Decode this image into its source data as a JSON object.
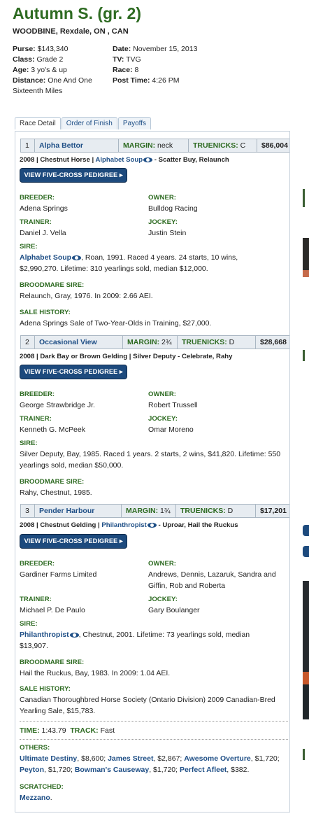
{
  "race": {
    "title": "Autumn S. (gr. 2)",
    "location": "WOODBINE, Rexdale, ON , CAN",
    "info_left": [
      {
        "label": "Purse:",
        "value": "$143,340"
      },
      {
        "label": "Class:",
        "value": "Grade 2"
      },
      {
        "label": "Age:",
        "value": "3 yo's & up"
      },
      {
        "label": "Distance:",
        "value": "One And One Sixteenth Miles"
      }
    ],
    "info_right": [
      {
        "label": "Date:",
        "value": "November 15, 2013"
      },
      {
        "label": "TV:",
        "value": "TVG"
      },
      {
        "label": "Race:",
        "value": "8"
      },
      {
        "label": "Post Time:",
        "value": "4:26 PM"
      }
    ]
  },
  "tabs": [
    "Race Detail",
    "Order of Finish",
    "Payoffs"
  ],
  "labels": {
    "margin": "MARGIN:",
    "truenicks": "TRUENICKS:",
    "pedigree_button": "VIEW FIVE-CROSS PEDIGREE",
    "breeder": "BREEDER:",
    "owner": "OWNER:",
    "trainer": "TRAINER:",
    "jockey": "JOCKEY:",
    "sire": "SIRE:",
    "broodmare_sire": "BROODMARE SIRE:",
    "sale_history": "SALE HISTORY:",
    "time": "TIME:",
    "track": "TRACK:",
    "others": "OTHERS:",
    "scratched": "SCRATCHED:"
  },
  "horses": [
    {
      "pos": "1",
      "name": "Alpha Bettor",
      "margin": "neck",
      "truenicks": "C",
      "earnings": "$86,004",
      "desc_pre": "2008 | Chestnut Horse | ",
      "desc_link": "Alphabet Soup",
      "desc_post": " - Scatter Buy, Relaunch",
      "breeder": "Adena Springs",
      "owner": "Bulldog Racing",
      "trainer": "Daniel J. Vella",
      "jockey": "Justin Stein",
      "sire_link": "Alphabet Soup",
      "sire_text": ", Roan, 1991. Raced 4 years. 24 starts, 10 wins, $2,990,270. Lifetime: 310 yearlings sold, median $12,000.",
      "bms": "Relaunch, Gray, 1976. In 2009: 2.66 AEI.",
      "sale": "Adena Springs Sale of Two-Year-Olds in Training, $27,000."
    },
    {
      "pos": "2",
      "name": "Occasional View",
      "margin": "2¾",
      "truenicks": "D",
      "earnings": "$28,668",
      "desc_pre": "2008 | Dark Bay or Brown Gelding | Silver Deputy - Celebrate, Rahy",
      "desc_link": "",
      "desc_post": "",
      "breeder": "George Strawbridge Jr.",
      "owner": "Robert Trussell",
      "trainer": "Kenneth G. McPeek",
      "jockey": "Omar Moreno",
      "sire_link": "",
      "sire_text": "Silver Deputy, Bay, 1985. Raced 1 years. 2 starts, 2 wins, $41,820. Lifetime: 550 yearlings sold, median $50,000.",
      "bms": "Rahy, Chestnut, 1985.",
      "sale": ""
    },
    {
      "pos": "3",
      "name": "Pender Harbour",
      "margin": "1¾",
      "truenicks": "D",
      "earnings": "$17,201",
      "desc_pre": "2008 | Chestnut Gelding | ",
      "desc_link": "Philanthropist",
      "desc_post": " - Uproar, Hail the Ruckus",
      "breeder": "Gardiner Farms Limited",
      "owner": "Andrews, Dennis, Lazaruk, Sandra and Giffin, Rob and Roberta",
      "trainer": "Michael P. De Paulo",
      "jockey": "Gary Boulanger",
      "sire_link": "Philanthropist",
      "sire_text": ", Chestnut, 2001. Lifetime: 73 yearlings sold, median $13,907.",
      "bms": "Hail the Ruckus, Bay, 1983. In 2009: 1.04 AEI.",
      "sale": "Canadian Thoroughbred Horse Society (Ontario Division) 2009 Canadian-Bred Yearling Sale, $15,783."
    }
  ],
  "time": "1:43.79",
  "track": "Fast",
  "others": [
    {
      "name": "Ultimate Destiny",
      "amt": ", $8,600; "
    },
    {
      "name": "James Street",
      "amt": ", $2,867; "
    },
    {
      "name": "Awesome Overture",
      "amt": ", $1,720; "
    },
    {
      "name": "Peyton",
      "amt": ", $1,720; "
    },
    {
      "name": "Bowman's Causeway",
      "amt": ", $1,720; "
    },
    {
      "name": "Perfect Afleet",
      "amt": ", $382."
    }
  ],
  "scratched": "Mezzano",
  "scratched_suffix": "."
}
